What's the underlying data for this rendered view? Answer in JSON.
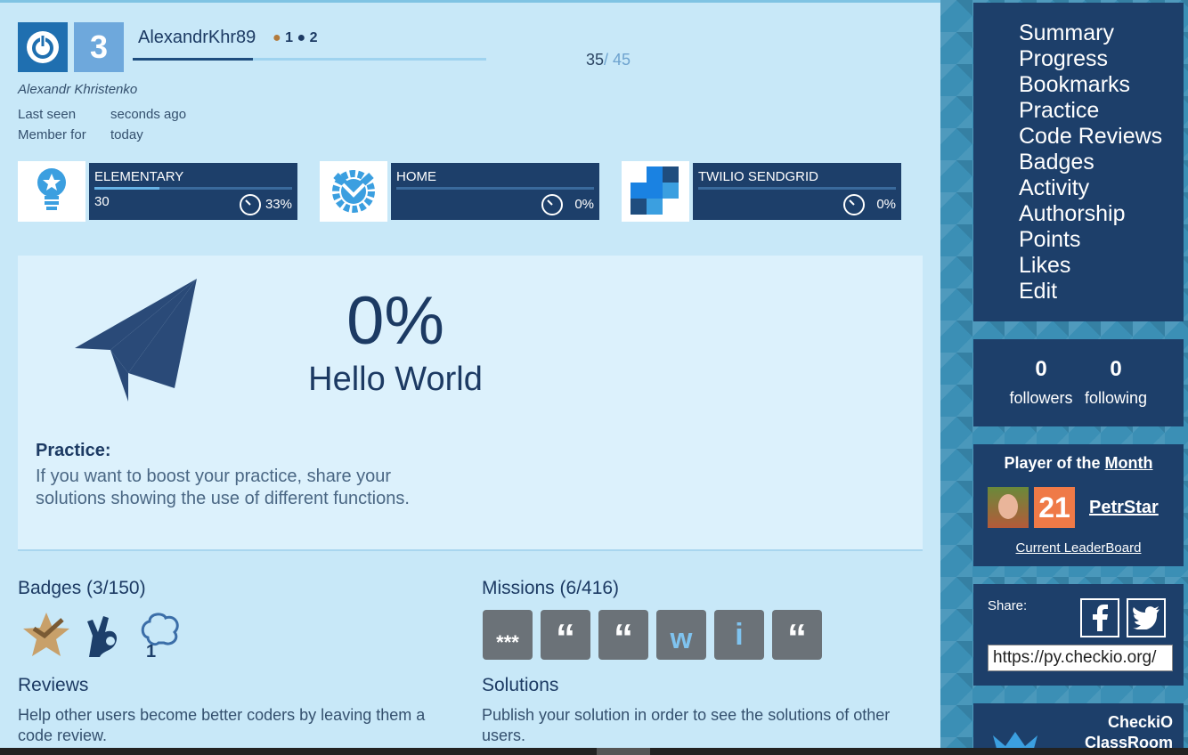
{
  "profile": {
    "username": "AlexandrKhr89",
    "rank_bronze": "1",
    "rank_dark": "2",
    "level": "3",
    "xp_current": "35",
    "xp_total": "/ 45",
    "xp_fraction": 0.34,
    "real_name": "Alexandr Khristenko",
    "last_seen_label": "Last seen",
    "last_seen_value": "seconds ago",
    "member_label": "Member for",
    "member_value": "today"
  },
  "islands": [
    {
      "name": "ELEMENTARY",
      "count": "30",
      "percent": "33%",
      "fraction": 0.33,
      "icon": "lightbulb-icon"
    },
    {
      "name": "HOME",
      "count": "",
      "percent": "0%",
      "fraction": 0,
      "icon": "gear-shield-icon"
    },
    {
      "name": "TWILIO SENDGRID",
      "count": "",
      "percent": "0%",
      "fraction": 0,
      "icon": "sendgrid-logo-icon"
    }
  ],
  "practice": {
    "percent": "0%",
    "mission": "Hello World",
    "heading": "Practice:",
    "text": "If you want to boost your practice, share your solutions showing the use of different functions."
  },
  "badges": {
    "title": "Badges (3/150)"
  },
  "missions": {
    "title": "Missions (6/416)",
    "tiles": [
      "***",
      "“",
      "“",
      "w",
      "i",
      "“"
    ]
  },
  "reviews": {
    "title": "Reviews",
    "text": "Help other users become better coders by leaving them a code review."
  },
  "solutions": {
    "title": "Solutions",
    "text": "Publish your solution in order to see the solutions of other users."
  },
  "sidebar": {
    "menu": [
      "Summary",
      "Progress",
      "Bookmarks",
      "Practice",
      "Code Reviews",
      "Badges",
      "Activity",
      "Authorship",
      "Points",
      "Likes",
      "Edit"
    ],
    "followers_count": "0",
    "followers_label": "followers",
    "following_count": "0",
    "following_label": "following",
    "potm_title_prefix": "Player of the ",
    "potm_title_link": "Month",
    "potm_level": "21",
    "potm_name": "PetrStar",
    "leaderboard": "Current LeaderBoard",
    "share_label": "Share:",
    "share_url": "https://py.checkio.org/",
    "classroom_line1": "CheckiO",
    "classroom_line2": "ClassRoom"
  },
  "colors": {
    "navy": "#1d3f6a",
    "accent": "#1f6fb0",
    "orange": "#ef7a47",
    "bg": "#c8e8f8"
  }
}
